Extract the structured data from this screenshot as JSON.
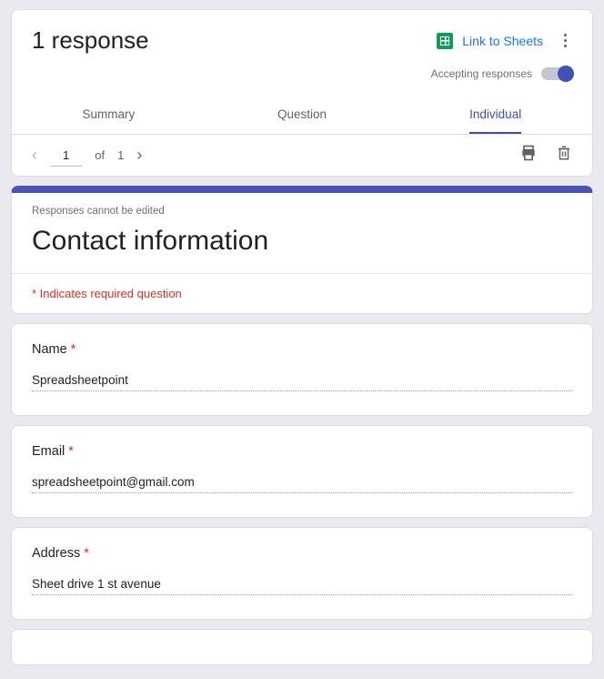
{
  "header": {
    "title": "1 response",
    "link_to_sheets": "Link to Sheets",
    "accepting_label": "Accepting responses"
  },
  "tabs": {
    "summary": "Summary",
    "question": "Question",
    "individual": "Individual"
  },
  "pager": {
    "current": "1",
    "of_label": "of",
    "total": "1"
  },
  "form": {
    "cannot_edit": "Responses cannot be edited",
    "title": "Contact information",
    "required_note": "* Indicates required question"
  },
  "questions": [
    {
      "label": "Name",
      "required": true,
      "answer": "Spreadsheetpoint",
      "full": false
    },
    {
      "label": "Email",
      "required": true,
      "answer": "spreadsheetpoint@gmail.com",
      "full": false
    },
    {
      "label": "Address",
      "required": true,
      "answer": "Sheet drive 1 st avenue",
      "full": true
    }
  ]
}
